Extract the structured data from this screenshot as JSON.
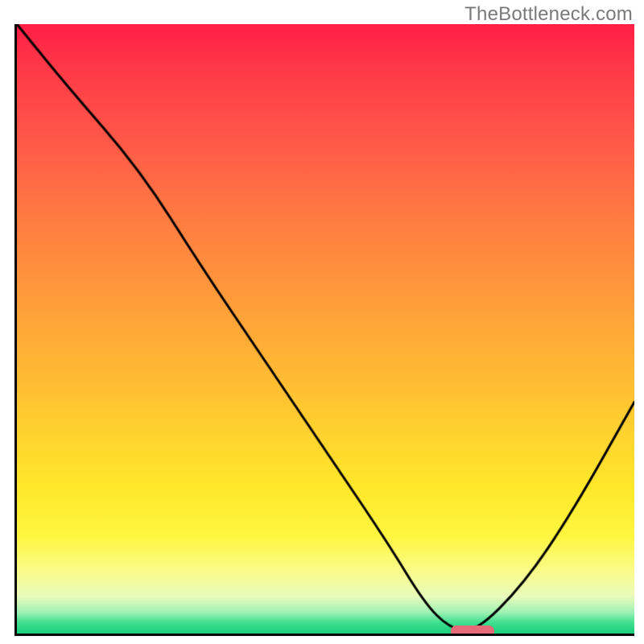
{
  "watermark": "TheBottleneck.com",
  "chart_data": {
    "type": "line",
    "title": "",
    "xlabel": "",
    "ylabel": "",
    "xlim": [
      0,
      100
    ],
    "ylim": [
      0,
      100
    ],
    "series": [
      {
        "name": "bottleneck-curve",
        "x": [
          0,
          8,
          20,
          30,
          40,
          50,
          60,
          66,
          70,
          74,
          82,
          90,
          100
        ],
        "y": [
          100,
          90,
          76,
          60,
          45,
          30,
          15,
          5,
          1,
          0,
          8,
          20,
          38
        ]
      }
    ],
    "marker": {
      "x_start": 70,
      "x_end": 77,
      "y": 0
    },
    "grid": false,
    "legend": false
  },
  "colors": {
    "curve": "#000000",
    "marker": "#e46b77",
    "axis": "#000000"
  }
}
